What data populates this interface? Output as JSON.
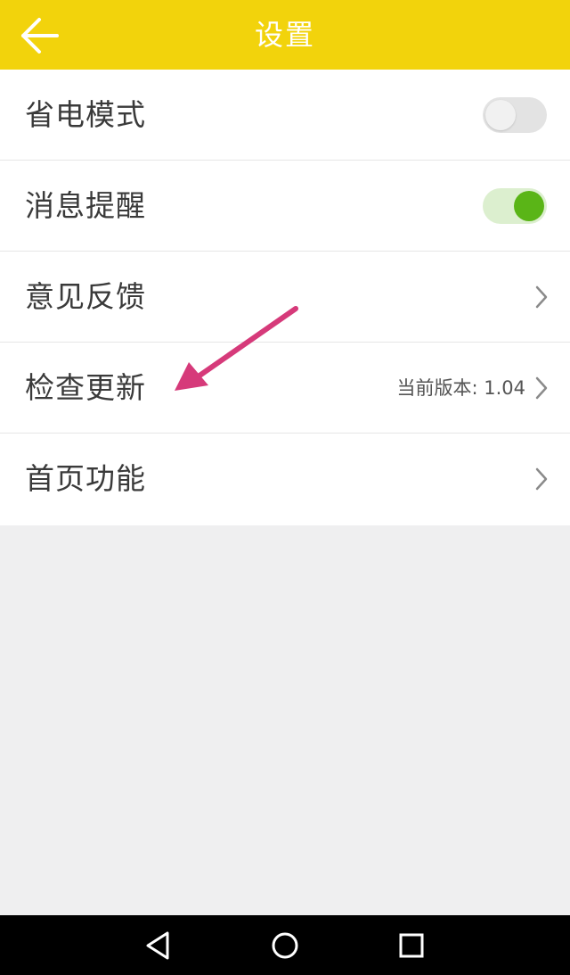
{
  "header": {
    "title": "设置",
    "back_icon": "arrow-left-icon",
    "background": "#f2d30c"
  },
  "settings": [
    {
      "label": "省电模式",
      "control": "toggle",
      "enabled": false
    },
    {
      "label": "消息提醒",
      "control": "toggle",
      "enabled": true
    },
    {
      "label": "意见反馈",
      "control": "chevron"
    },
    {
      "label": "检查更新",
      "control": "chevron",
      "value": "当前版本: 1.04"
    },
    {
      "label": "首页功能",
      "control": "chevron"
    }
  ],
  "annotation": {
    "icon": "pointer-arrow-icon",
    "color": "#d63a7a"
  },
  "navbar": {
    "back": "triangle-back-icon",
    "home": "circle-home-icon",
    "recents": "square-recents-icon"
  },
  "colors": {
    "toggle_on": "#5ab517",
    "toggle_off": "#e3e3e3",
    "background": "#efeff0"
  }
}
